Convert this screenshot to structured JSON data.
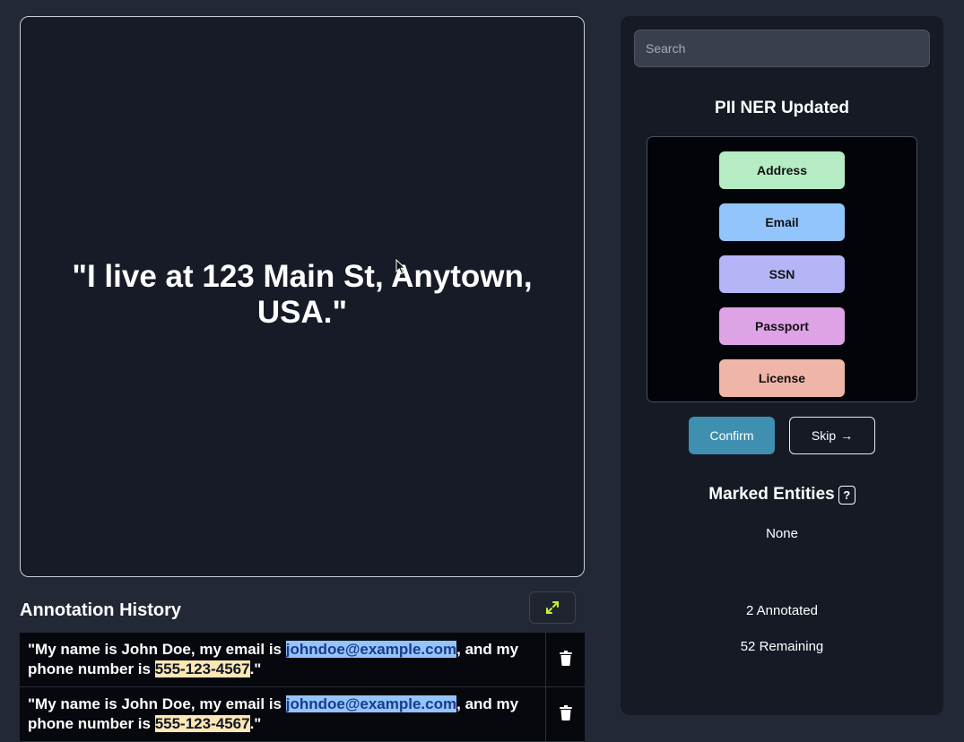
{
  "main": {
    "current_text": "\"I live at 123 Main St, Anytown, USA.\""
  },
  "history": {
    "title": "Annotation History",
    "rows": [
      {
        "prefix": "\"My name is John Doe, my email is ",
        "email": "johndoe@example.com",
        "middle": ", and my phone number is ",
        "phone": "555-123-4567",
        "suffix": ".\""
      },
      {
        "prefix": "\"My name is John Doe, my email is ",
        "email": "johndoe@example.com",
        "middle": ", and my phone number is ",
        "phone": "555-123-4567",
        "suffix": ".\""
      }
    ]
  },
  "sidebar": {
    "search_placeholder": "Search",
    "project_title": "PII NER Updated",
    "labels": [
      {
        "name": "Address",
        "color": "#b5ecc4"
      },
      {
        "name": "Email",
        "color": "#93c5fd"
      },
      {
        "name": "SSN",
        "color": "#b3b5f7"
      },
      {
        "name": "Passport",
        "color": "#dea2e6"
      },
      {
        "name": "License",
        "color": "#efb5a8"
      }
    ],
    "confirm_label": "Confirm",
    "skip_label": "Skip",
    "skip_arrow": "→",
    "entities_title": "Marked Entities",
    "help_icon": "?",
    "entities_none": "None",
    "annotated": "2 Annotated",
    "remaining": "52 Remaining"
  },
  "colors": {
    "email_highlight": "#93c5fd",
    "phone_highlight": "#fde7b5",
    "confirm": "#3e8fb0",
    "expand_icon": "#c6f135"
  }
}
